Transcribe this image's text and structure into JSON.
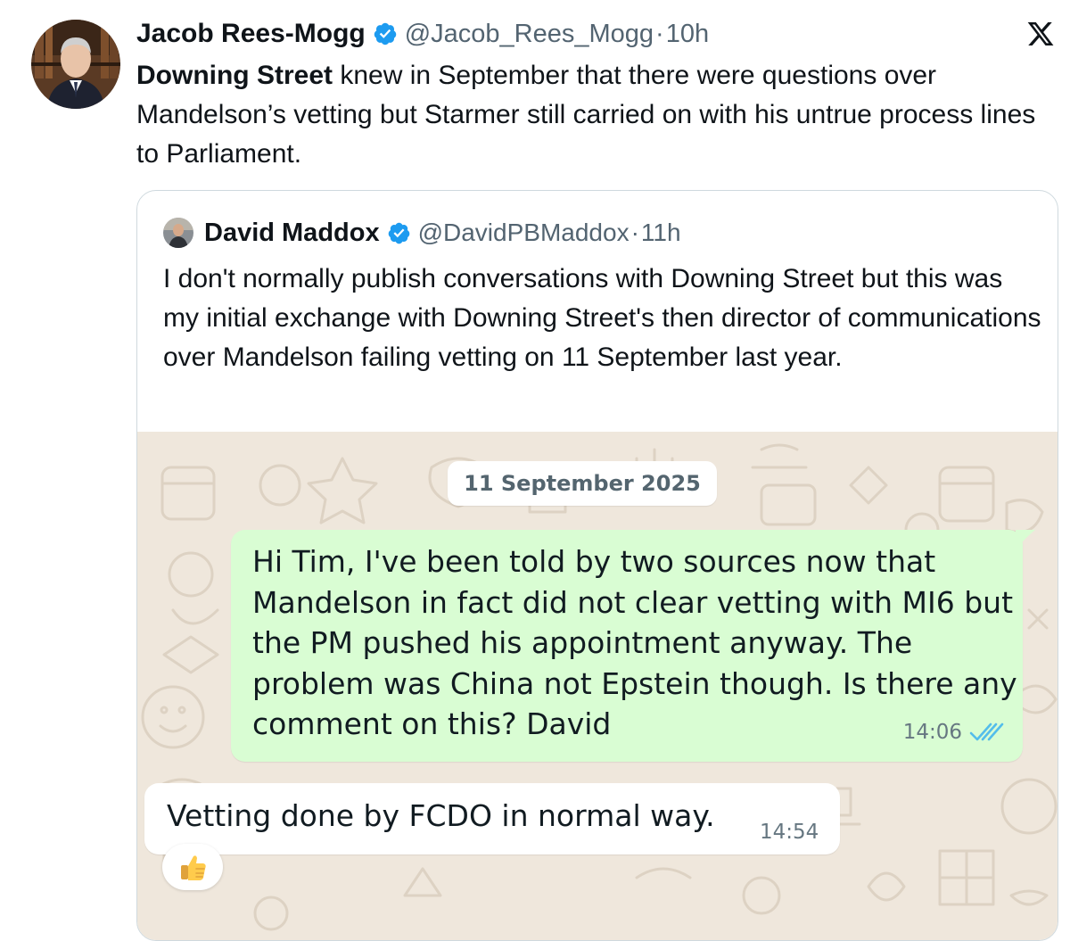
{
  "tweet": {
    "author_name": "Jacob Rees-Mogg",
    "handle": "@Jacob_Rees_Mogg",
    "separator": "·",
    "time": "10h",
    "text_bold": "Downing Street",
    "text_rest": " knew in September that there were questions over Mandelson’s vetting but Starmer still carried on with his untrue process lines to Parliament.",
    "platform_icon": "x-logo-icon",
    "verified_color": "#1d9bf0"
  },
  "quoted_tweet": {
    "author_name": "David Maddox",
    "handle": "@DavidPBMaddox",
    "separator": "·",
    "time": "11h",
    "text": "I don't normally publish conversations with Downing Street but this was my initial exchange with Downing Street's then director of communications over Mandelson failing vetting on 11 September last year."
  },
  "chat": {
    "date_label": "11 September 2025",
    "outgoing_message": {
      "text": "Hi Tim, I've been told by two sources now that Mandelson in fact did not clear vetting with MI6 but the PM pushed his appointment anyway. The problem was China not Epstein though. Is there any comment on this? David",
      "time": "14:06",
      "status_icon": "double-check-read-icon"
    },
    "incoming_message": {
      "text": "Vetting done by FCDO in normal way.",
      "time": "14:54",
      "reaction": "👍"
    },
    "colors": {
      "wallpaper": "#efe7dc",
      "outgoing_bubble": "#d9fdd3",
      "incoming_bubble": "#ffffff",
      "read_ticks": "#53bdeb"
    }
  }
}
